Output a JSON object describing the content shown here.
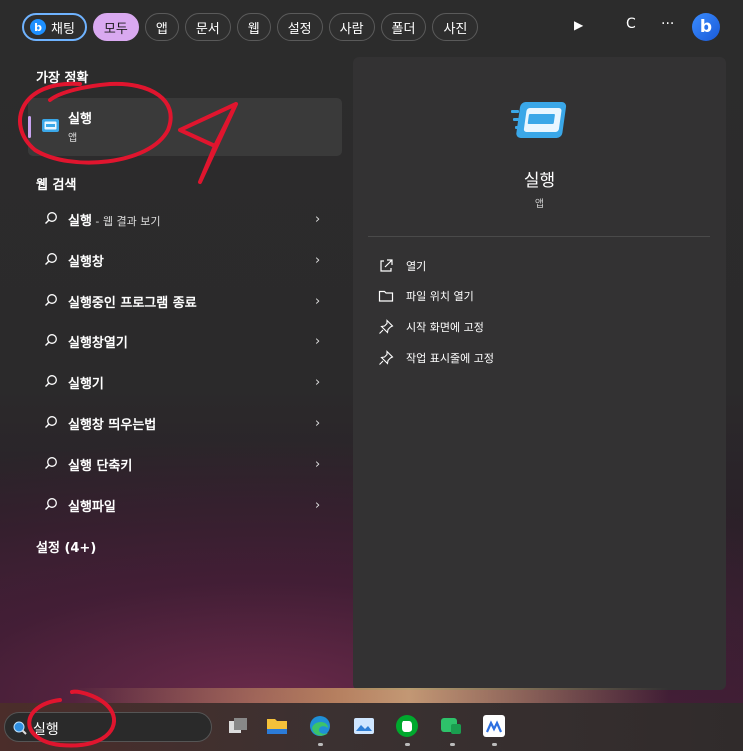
{
  "topbar": {
    "tabs": [
      {
        "label": "채팅",
        "type": "chat"
      },
      {
        "label": "모두",
        "type": "active"
      },
      {
        "label": "앱"
      },
      {
        "label": "문서"
      },
      {
        "label": "웹"
      },
      {
        "label": "설정"
      },
      {
        "label": "사람"
      },
      {
        "label": "폴더"
      },
      {
        "label": "사진"
      }
    ],
    "play_icon": "▶",
    "c_label": "C",
    "more_icon": "···",
    "bing_label": "b"
  },
  "best_match": {
    "section_title": "가장 정확",
    "name": "실행",
    "kind": "앱"
  },
  "web_search": {
    "section_title": "웹 검색",
    "results": [
      {
        "text": "실행",
        "sub": " - 웹 결과 보기"
      },
      {
        "text": "실행창",
        "sub": ""
      },
      {
        "text": "실행중인 프로그램 종료",
        "sub": ""
      },
      {
        "text": "실행창열기",
        "sub": ""
      },
      {
        "text": "실행기",
        "sub": ""
      },
      {
        "text": "실행창 띄우는법",
        "sub": ""
      },
      {
        "text": "실행 단축키",
        "sub": ""
      },
      {
        "text": "실행파일",
        "sub": ""
      }
    ],
    "chevron": "›"
  },
  "settings_section": {
    "title": "설정 (4+)"
  },
  "detail": {
    "title": "실행",
    "kind": "앱",
    "actions": [
      {
        "label": "열기",
        "icon": "open-external-icon"
      },
      {
        "label": "파일 위치 열기",
        "icon": "folder-icon"
      },
      {
        "label": "시작 화면에 고정",
        "icon": "pin-icon"
      },
      {
        "label": "작업 표시줄에 고정",
        "icon": "pin-icon"
      }
    ]
  },
  "taskbar": {
    "search_query": "실행",
    "apps": [
      "task-view-icon",
      "file-explorer-icon",
      "edge-icon",
      "photos-icon",
      "evernote-icon",
      "app-green-icon",
      "messenger-icon",
      "app-bears-icon"
    ]
  },
  "colors": {
    "accent": "#d9a9f0",
    "annotation": "#e0152e"
  }
}
